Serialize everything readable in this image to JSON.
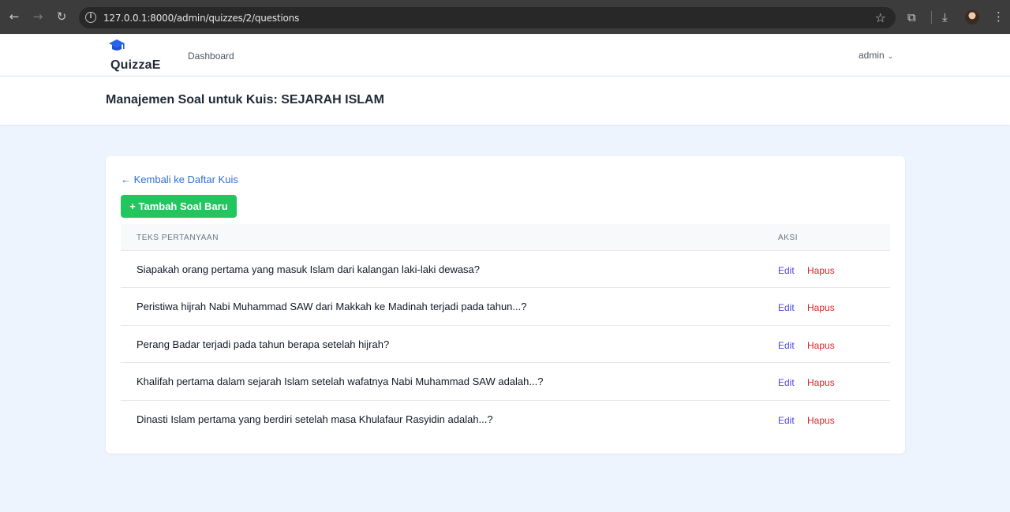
{
  "browser": {
    "url": "127.0.0.1:8000/admin/quizzes/2/questions"
  },
  "nav": {
    "brand": "QuizzaE",
    "links": [
      "Dashboard"
    ],
    "user": "admin"
  },
  "page": {
    "title": "Manajemen Soal untuk Kuis: SEJARAH ISLAM"
  },
  "content": {
    "back_link": "← Kembali ke Daftar Kuis",
    "add_button": "+ Tambah Soal Baru",
    "table": {
      "headers": [
        "TEKS PERTANYAAN",
        "AKSI"
      ],
      "rows": [
        {
          "question": "Siapakah orang pertama yang masuk Islam dari kalangan laki-laki dewasa?",
          "edit": "Edit",
          "delete": "Hapus"
        },
        {
          "question": "Peristiwa hijrah Nabi Muhammad SAW dari Makkah ke Madinah terjadi pada tahun...?",
          "edit": "Edit",
          "delete": "Hapus"
        },
        {
          "question": "Perang Badar terjadi pada tahun berapa setelah hijrah?",
          "edit": "Edit",
          "delete": "Hapus"
        },
        {
          "question": "Khalifah pertama dalam sejarah Islam setelah wafatnya Nabi Muhammad SAW adalah...?",
          "edit": "Edit",
          "delete": "Hapus"
        },
        {
          "question": "Dinasti Islam pertama yang berdiri setelah masa Khulafaur Rasyidin adalah...?",
          "edit": "Edit",
          "delete": "Hapus"
        }
      ]
    }
  },
  "colors": {
    "accent_green": "#22c55e",
    "link_blue": "#2f6fd6",
    "edit_indigo": "#4f46e5",
    "delete_red": "#dc2626",
    "page_bg": "#eef4fd"
  }
}
